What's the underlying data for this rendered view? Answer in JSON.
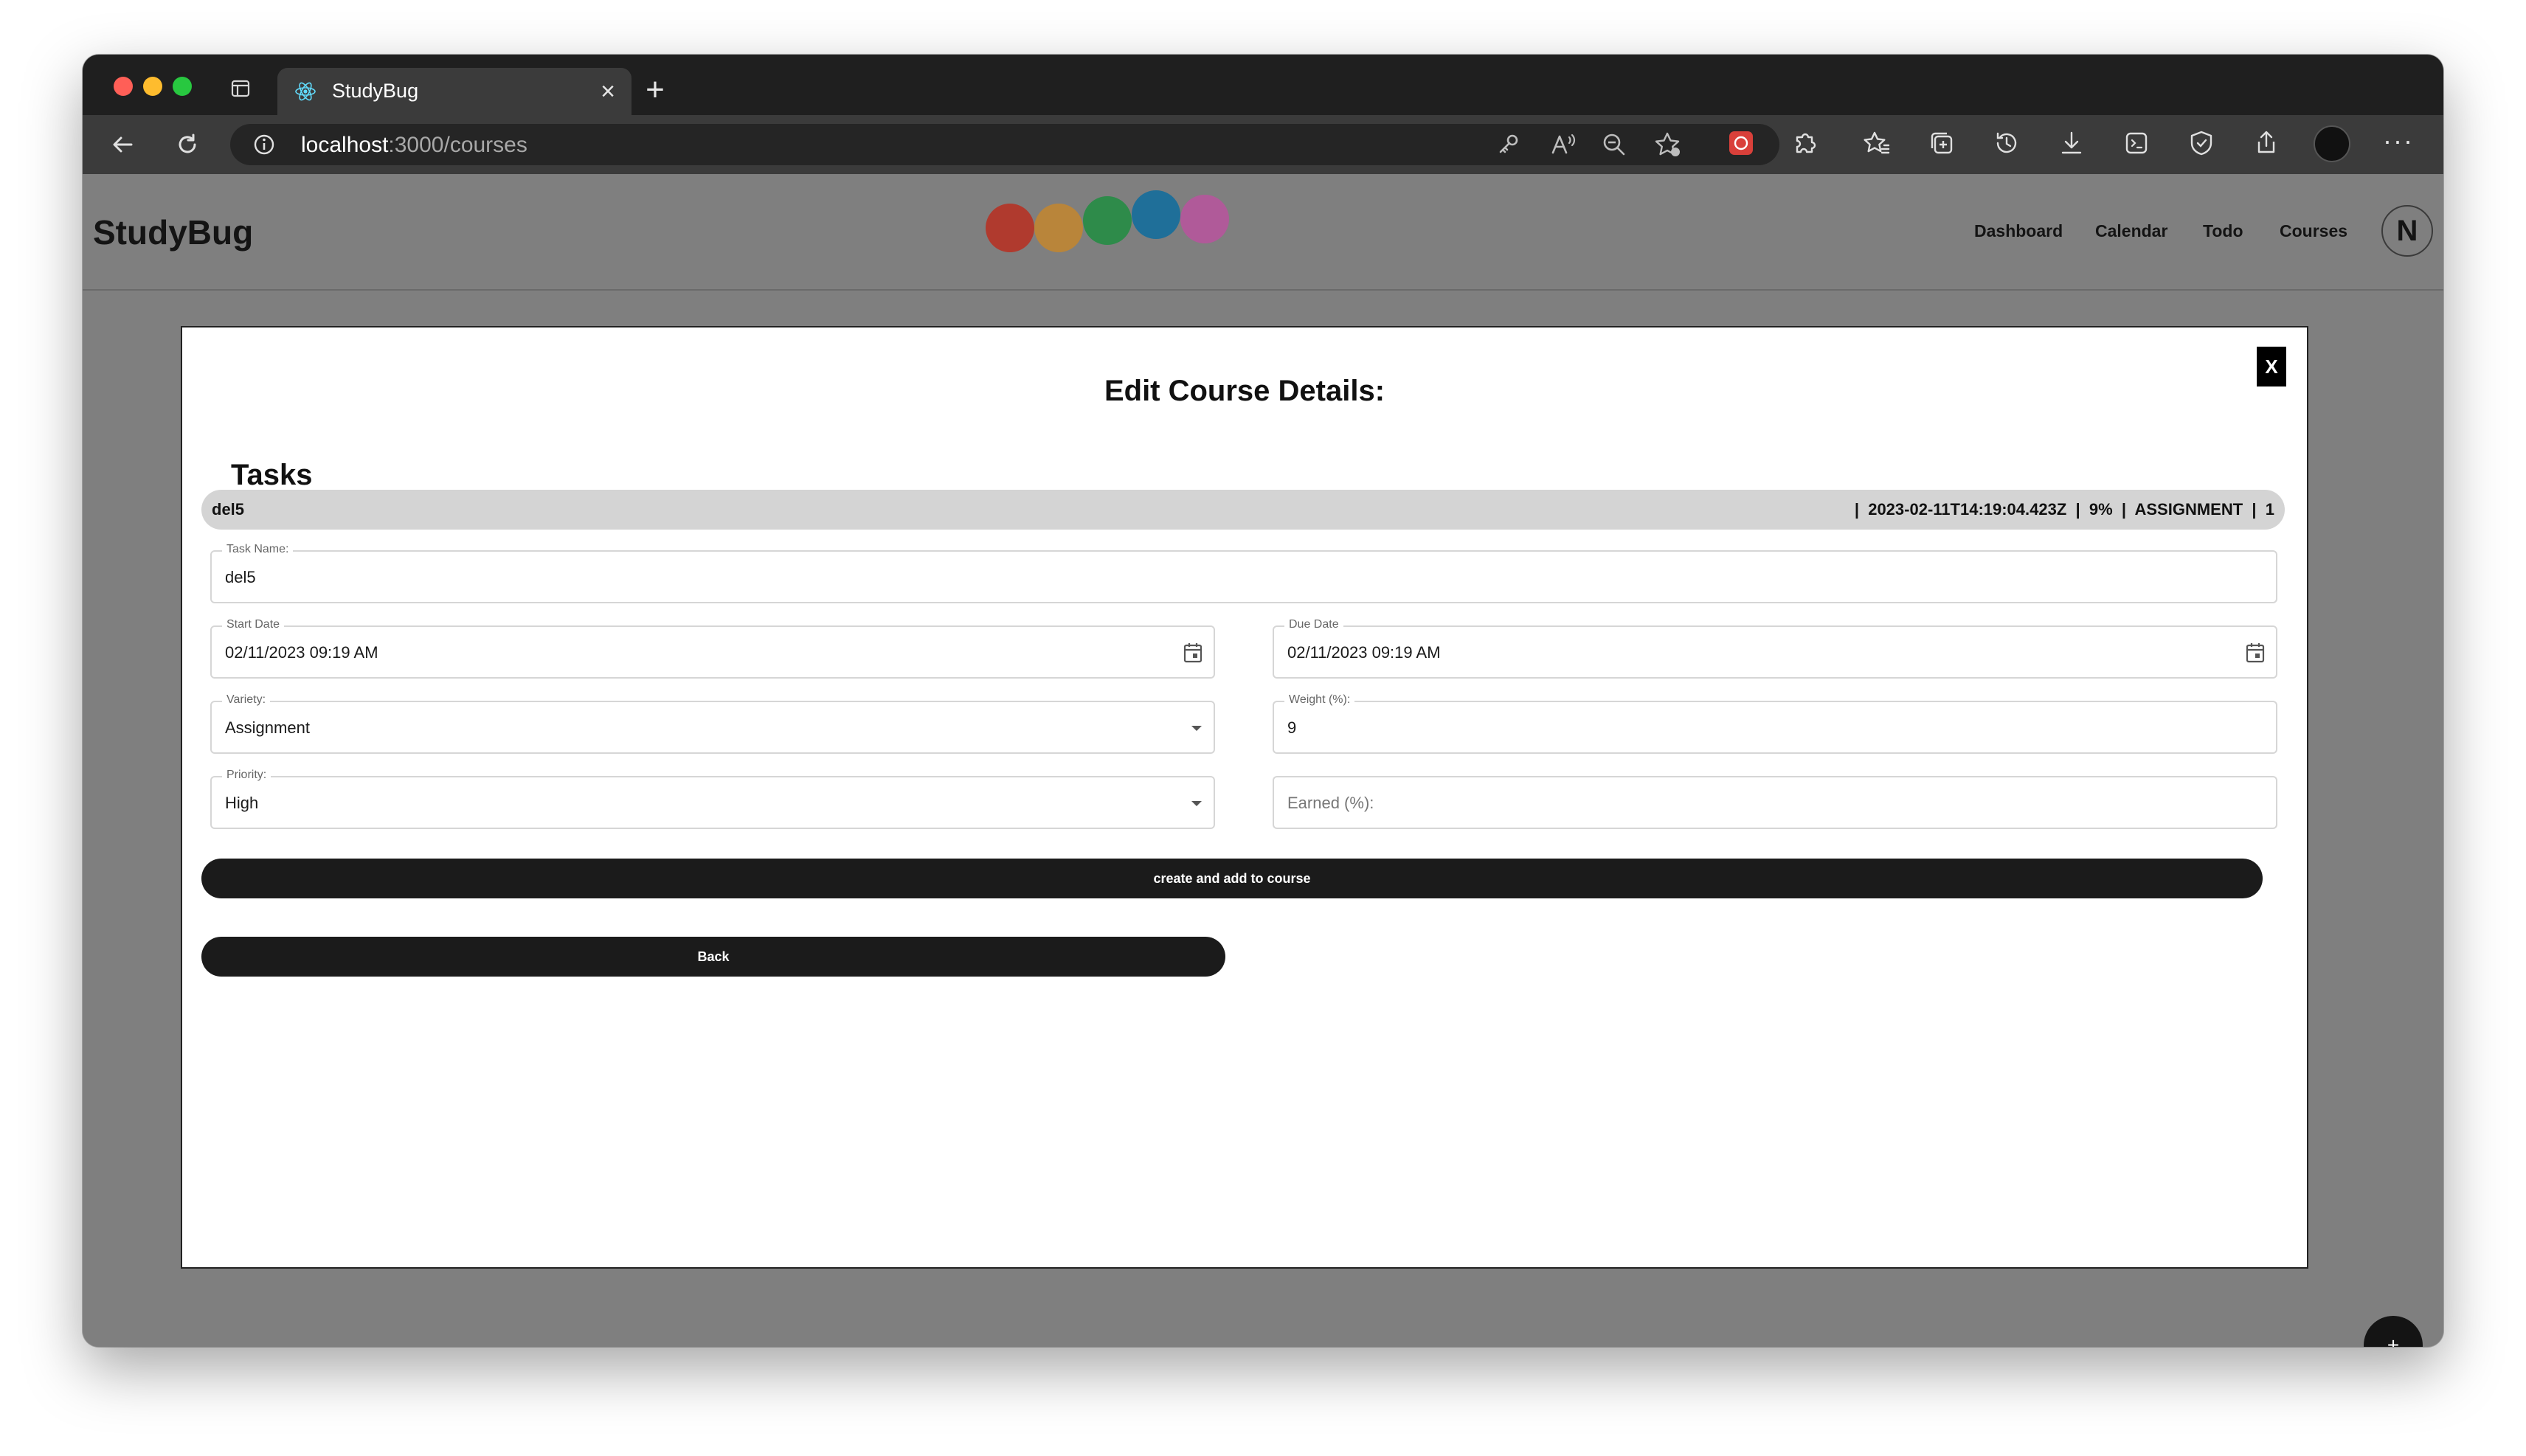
{
  "browser": {
    "tab_title": "StudyBug",
    "url_host": "localhost",
    "url_path": ":3000/courses"
  },
  "app": {
    "brand": "StudyBug",
    "nav": [
      "Dashboard",
      "Calendar",
      "Todo",
      "Courses"
    ],
    "avatar_initial": "N",
    "fab_label": "+",
    "logo_dot_colors": [
      "#b03a2e",
      "#b9853a",
      "#2e8b4a",
      "#1f6f99",
      "#b05a99"
    ]
  },
  "modal": {
    "close_label": "X",
    "title": "Edit Course Details:",
    "tasks_heading": "Tasks",
    "task_row": {
      "name": "del5",
      "meta": "|  2023-02-11T14:19:04.423Z  |  9%  |  ASSIGNMENT  |  1"
    },
    "form": {
      "task_name": {
        "label": "Task Name:",
        "value": "del5"
      },
      "start_date": {
        "label": "Start Date",
        "value": "02/11/2023 09:19 AM"
      },
      "due_date": {
        "label": "Due Date",
        "value": "02/11/2023 09:19 AM"
      },
      "variety": {
        "label": "Variety:",
        "value": "Assignment"
      },
      "weight": {
        "label": "Weight (%):",
        "value": "9"
      },
      "priority": {
        "label": "Priority:",
        "value": "High"
      },
      "earned": {
        "placeholder": "Earned (%):"
      }
    },
    "buttons": {
      "create": "create and add to course",
      "back": "Back"
    }
  }
}
